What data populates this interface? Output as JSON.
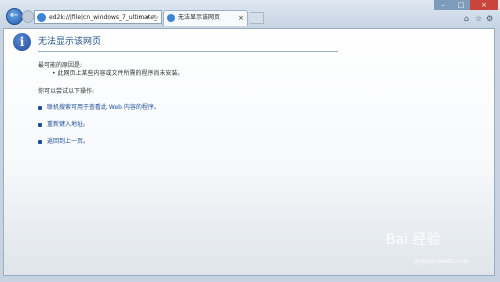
{
  "address": {
    "url": "ed2k://|file|cn_windows_7_ultimate_",
    "controls": "⌕ ▾ ↻"
  },
  "tab": {
    "title": "无法显示该网页",
    "close": "×"
  },
  "window": {
    "min": "–",
    "max": "□",
    "close": "×"
  },
  "tools": {
    "home": "⌂",
    "favorites": "☆",
    "settings": "⚙"
  },
  "page": {
    "heading": "无法显示该网页",
    "cause_title": "最可能的原因是:",
    "cause_item": "• 此网页上某些内容或文件所需的程序尚未安装。",
    "try_title": "你可以尝试以下操作:",
    "options": [
      "联机搜索可用于查看此 Web 内容的程序。",
      "重新键入地址。",
      "返回到上一页。"
    ]
  },
  "watermark": {
    "logo": "Bai 经验",
    "sub": "jingyan.baidu.com"
  }
}
